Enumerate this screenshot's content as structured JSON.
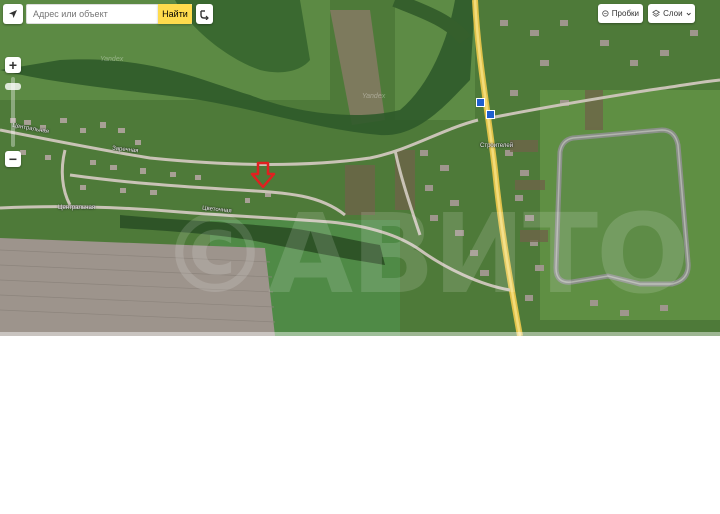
{
  "search": {
    "placeholder": "Адрес или объект",
    "button_label": "Найти"
  },
  "controls": {
    "traffic_label": "Пробки",
    "layers_label": "Слои",
    "zoom_in_label": "+",
    "zoom_out_label": "−",
    "zoom_level_fraction": 0.1
  },
  "road_labels": [
    "Заречная",
    "Центральная",
    "Центральная",
    "Цветочная",
    "Строителей"
  ],
  "map_watermarks": {
    "provider": "Yandex",
    "overlay": "©АВИТО"
  },
  "map_icons": [
    "geolocation-icon",
    "route-icon",
    "traffic-icon",
    "layers-icon",
    "chevron-down-icon",
    "location-arrow-marker-icon",
    "road-shield-icon"
  ],
  "colors": {
    "search_button": "#ffdb4d",
    "marker": "#e02020",
    "highway": "#e7c84a"
  }
}
